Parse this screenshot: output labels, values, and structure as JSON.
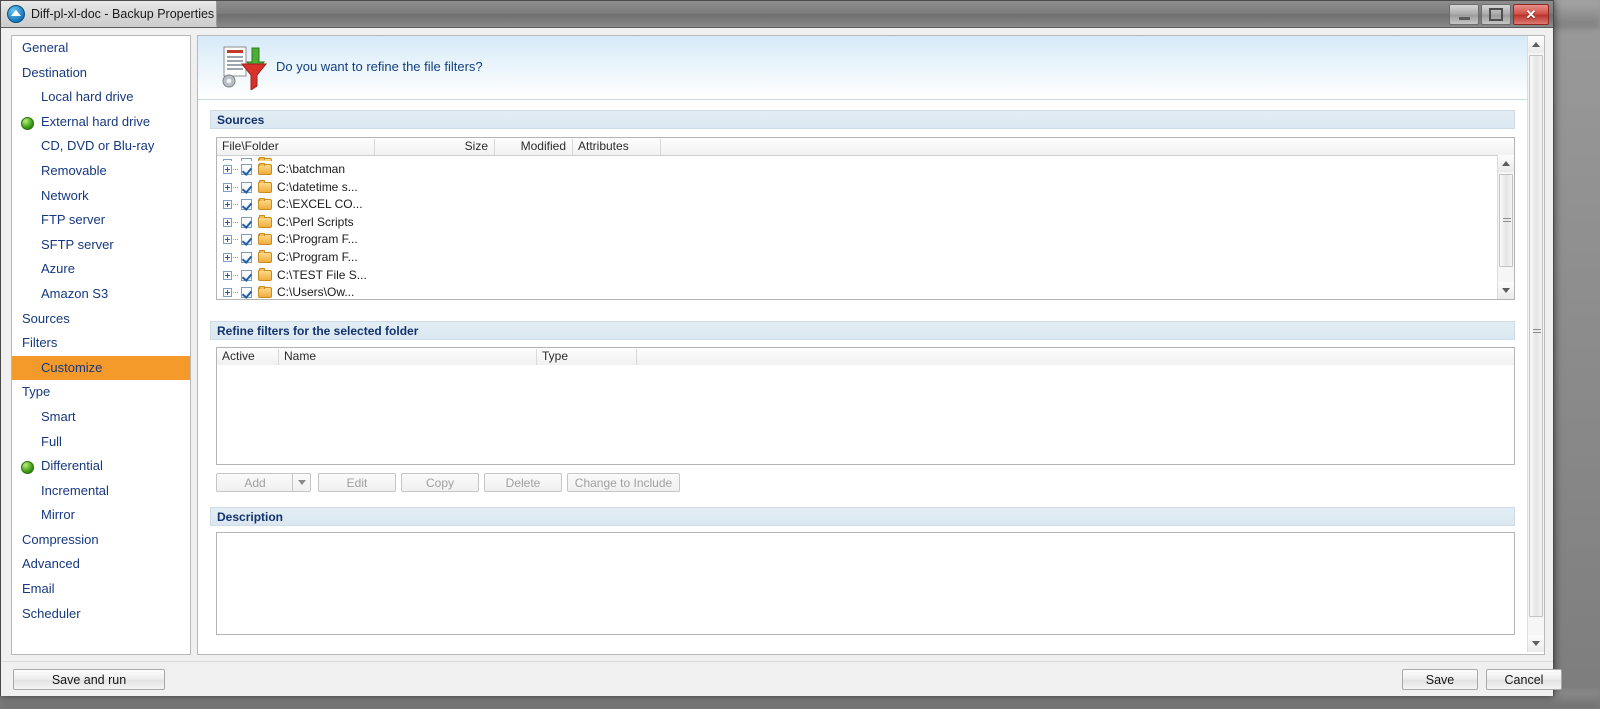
{
  "window": {
    "title": "Diff-pl-xl-doc - Backup Properties",
    "app_icon": "backup-circle-icon",
    "controls": {
      "minimize": "minimize-icon",
      "maximize": "maximize-icon",
      "close": "close-icon"
    }
  },
  "sidebar": {
    "items": [
      {
        "label": "General",
        "level": 0,
        "bullet": false,
        "selected": false
      },
      {
        "label": "Destination",
        "level": 0,
        "bullet": false,
        "selected": false
      },
      {
        "label": "Local hard drive",
        "level": 1,
        "bullet": false,
        "selected": false
      },
      {
        "label": "External hard drive",
        "level": 1,
        "bullet": true,
        "selected": false
      },
      {
        "label": "CD, DVD or Blu-ray",
        "level": 1,
        "bullet": false,
        "selected": false
      },
      {
        "label": "Removable",
        "level": 1,
        "bullet": false,
        "selected": false
      },
      {
        "label": "Network",
        "level": 1,
        "bullet": false,
        "selected": false
      },
      {
        "label": "FTP server",
        "level": 1,
        "bullet": false,
        "selected": false
      },
      {
        "label": "SFTP server",
        "level": 1,
        "bullet": false,
        "selected": false
      },
      {
        "label": "Azure",
        "level": 1,
        "bullet": false,
        "selected": false
      },
      {
        "label": "Amazon S3",
        "level": 1,
        "bullet": false,
        "selected": false
      },
      {
        "label": "Sources",
        "level": 0,
        "bullet": false,
        "selected": false
      },
      {
        "label": "Filters",
        "level": 0,
        "bullet": false,
        "selected": false
      },
      {
        "label": "Customize",
        "level": 1,
        "bullet": false,
        "selected": true
      },
      {
        "label": "Type",
        "level": 0,
        "bullet": false,
        "selected": false
      },
      {
        "label": "Smart",
        "level": 1,
        "bullet": false,
        "selected": false
      },
      {
        "label": "Full",
        "level": 1,
        "bullet": false,
        "selected": false
      },
      {
        "label": "Differential",
        "level": 1,
        "bullet": true,
        "selected": false
      },
      {
        "label": "Incremental",
        "level": 1,
        "bullet": false,
        "selected": false
      },
      {
        "label": "Mirror",
        "level": 1,
        "bullet": false,
        "selected": false
      },
      {
        "label": "Compression",
        "level": 0,
        "bullet": false,
        "selected": false
      },
      {
        "label": "Advanced",
        "level": 0,
        "bullet": false,
        "selected": false
      },
      {
        "label": "Email",
        "level": 0,
        "bullet": false,
        "selected": false
      },
      {
        "label": "Scheduler",
        "level": 0,
        "bullet": false,
        "selected": false
      }
    ],
    "selection_color": "#f39a2b",
    "text_color": "#16387f"
  },
  "banner": {
    "question": "Do you want to refine the file filters?",
    "icon": "filter-funnel-icon"
  },
  "sources": {
    "section_title": "Sources",
    "columns": [
      "File\\Folder",
      "Size",
      "Modified",
      "Attributes"
    ],
    "rows": [
      {
        "name": "",
        "clipped": true
      },
      {
        "name": "C:\\batchman",
        "clipped": false
      },
      {
        "name": "C:\\datetime s...",
        "clipped": false
      },
      {
        "name": "C:\\EXCEL CO...",
        "clipped": false
      },
      {
        "name": "C:\\Perl Scripts",
        "clipped": false
      },
      {
        "name": "C:\\Program F...",
        "clipped": false
      },
      {
        "name": "C:\\Program F...",
        "clipped": false
      },
      {
        "name": "C:\\TEST File S...",
        "clipped": false
      },
      {
        "name": "C:\\Users\\Ow...",
        "clipped": false
      }
    ],
    "row_checked": true,
    "scrollbar": "sources-scrollbar"
  },
  "refine": {
    "section_title": "Refine filters for the selected folder",
    "columns": [
      "Active",
      "Name",
      "Type"
    ],
    "rows": [],
    "buttons": [
      {
        "label": "Add",
        "disabled": true,
        "dropdown": true
      },
      {
        "label": "Edit",
        "disabled": true,
        "dropdown": false
      },
      {
        "label": "Copy",
        "disabled": true,
        "dropdown": false
      },
      {
        "label": "Delete",
        "disabled": true,
        "dropdown": false
      },
      {
        "label": "Change to Include",
        "disabled": true,
        "dropdown": false
      }
    ]
  },
  "description": {
    "section_title": "Description",
    "value": ""
  },
  "footer": {
    "save_and_run": "Save and run",
    "save": "Save",
    "cancel": "Cancel"
  }
}
